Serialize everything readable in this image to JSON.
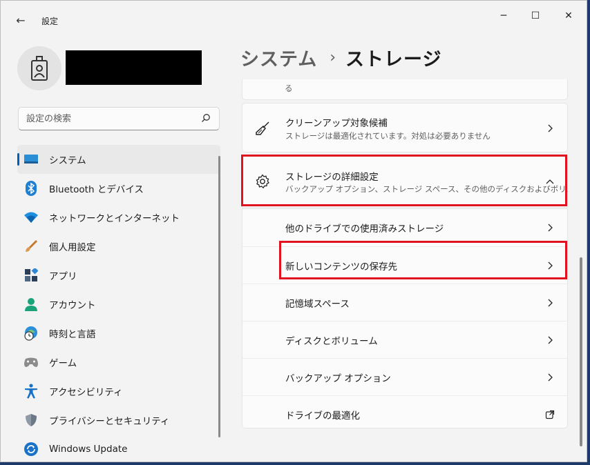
{
  "window": {
    "app_title": "設定",
    "back_label": "←",
    "minimize_label": "─",
    "maximize_label": "☐",
    "close_label": "✕"
  },
  "search": {
    "placeholder": "設定の検索",
    "value": ""
  },
  "sidebar": {
    "items": [
      {
        "label": "システム",
        "icon": "system-icon"
      },
      {
        "label": "Bluetooth とデバイス",
        "icon": "bluetooth-icon"
      },
      {
        "label": "ネットワークとインターネット",
        "icon": "network-icon"
      },
      {
        "label": "個人用設定",
        "icon": "brush-icon"
      },
      {
        "label": "アプリ",
        "icon": "apps-icon"
      },
      {
        "label": "アカウント",
        "icon": "account-icon"
      },
      {
        "label": "時刻と言語",
        "icon": "time-language-icon"
      },
      {
        "label": "ゲーム",
        "icon": "gamepad-icon"
      },
      {
        "label": "アクセシビリティ",
        "icon": "accessibility-icon"
      },
      {
        "label": "プライバシーとセキュリティ",
        "icon": "shield-icon"
      },
      {
        "label": "Windows Update",
        "icon": "windows-update-icon"
      }
    ]
  },
  "breadcrumb": {
    "parent": "システム",
    "separator": "›",
    "current": "ストレージ"
  },
  "main": {
    "partial_text": "る",
    "cleanup": {
      "title": "クリーンアップ対象候補",
      "subtitle": "ストレージは最適化されています。対処は必要ありません"
    },
    "advanced": {
      "title": "ストレージの詳細設定",
      "subtitle": "バックアップ オプション、ストレージ スペース、その他のディスクおよびボリューム"
    },
    "sub_items": [
      {
        "label": "他のドライブでの使用済みストレージ",
        "action": "chevron"
      },
      {
        "label": "新しいコンテンツの保存先",
        "action": "chevron"
      },
      {
        "label": "記憶域スペース",
        "action": "chevron"
      },
      {
        "label": "ディスクとボリューム",
        "action": "chevron"
      },
      {
        "label": "バックアップ オプション",
        "action": "chevron"
      },
      {
        "label": "ドライブの最適化",
        "action": "external-link"
      }
    ]
  },
  "colors": {
    "accent": "#005fb8",
    "highlight": "#e0121f",
    "background": "#f3f3f3"
  }
}
